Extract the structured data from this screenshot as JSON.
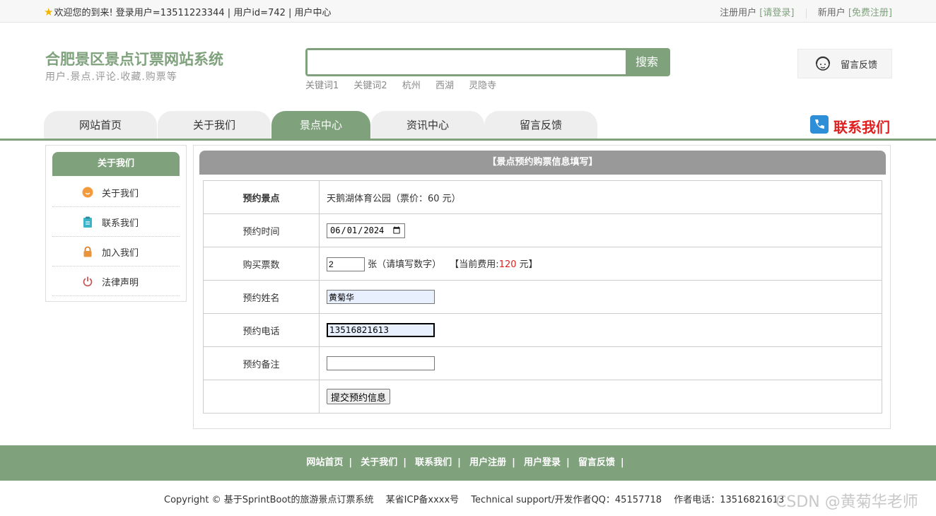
{
  "topbar": {
    "welcome": "欢迎您的到来!  登录用户=13511223344 | 用户id=742 | 用户中心",
    "register_prefix": "注册用户",
    "login_link": "[请登录]",
    "newuser_prefix": "新用户",
    "signup_link": "[免费注册]"
  },
  "header": {
    "title": "合肥景区景点订票网站系统",
    "subtitle": "用户.景点.评论.收藏.购票等",
    "search_placeholder": "",
    "search_button": "搜索",
    "keywords": [
      "关键词1",
      "关键词2",
      "杭州",
      "西湖",
      "灵隐寺"
    ],
    "feedback": "留言反馈"
  },
  "nav": {
    "tabs": [
      "网站首页",
      "关于我们",
      "景点中心",
      "资讯中心",
      "留言反馈"
    ],
    "active_index": 2,
    "contact": "联系我们"
  },
  "sidebar": {
    "title": "关于我们",
    "items": [
      "关于我们",
      "联系我们",
      "加入我们",
      "法律声明"
    ]
  },
  "form": {
    "heading": "【景点预约购票信息填写】",
    "spot_label": "预约景点",
    "spot_value": "天鹅湖体育公园（票价：60 元）",
    "time_label": "预约时间",
    "time_value": "2024-06-01",
    "count_label": "购买票数",
    "count_value": "2",
    "count_hint": "张（请填写数字）",
    "fee_prefix": "【当前费用:",
    "fee_value": "120",
    "fee_suffix": "元】",
    "name_label": "预约姓名",
    "name_value": "黄菊华",
    "phone_label": "预约电话",
    "phone_value": "13516821613",
    "remark_label": "预约备注",
    "remark_value": "",
    "submit_label": "提交预约信息"
  },
  "footer": {
    "links": [
      "网站首页",
      "关于我们",
      "联系我们",
      "用户注册",
      "用户登录",
      "留言反馈"
    ],
    "separator": "|",
    "copyright": "Copyright © 基于SprintBoot的旅游景点订票系统",
    "icp": "某省ICP备xxxx号",
    "support": "Technical support/开发作者QQ：45157718",
    "phone": "作者电话：13516821613"
  },
  "watermark": "CSDN @黄菊华老师",
  "colors": {
    "accent": "#7fa27d",
    "panel_head": "#999999",
    "price": "#e02020"
  }
}
